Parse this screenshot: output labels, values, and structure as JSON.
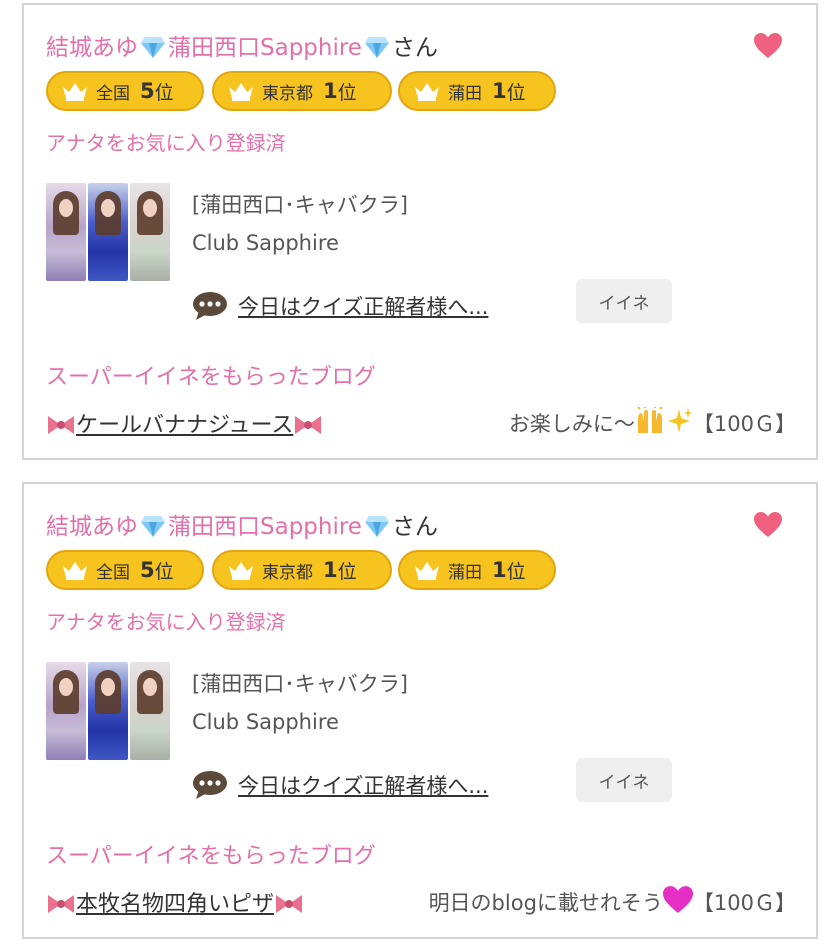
{
  "cards": [
    {
      "name_part1": "結城あゆ",
      "name_part2": "蒲田西口Sapphire",
      "name_suffix": "さん",
      "rank_national_label": "全国",
      "rank_national_value": "5",
      "rank_tokyo_label": "東京都",
      "rank_tokyo_value": "1",
      "rank_kamata_label": "蒲田",
      "rank_kamata_value": "1",
      "rank_unit": "位",
      "favorite_status": "アナタをお気に入り登録済",
      "category": "[蒲田西口･キャバクラ]",
      "shop": "Club Sapphire",
      "post_title": "今日はクイズ正解者様へ...",
      "iine_label": "イイネ",
      "super_iine_heading": "スーパーイイネをもらったブログ",
      "blog_title": "ケールバナナジュース",
      "blog_comment": "お楽しみに〜",
      "blog_points": "【100Ｇ】"
    },
    {
      "name_part1": "結城あゆ",
      "name_part2": "蒲田西口Sapphire",
      "name_suffix": "さん",
      "rank_national_label": "全国",
      "rank_national_value": "5",
      "rank_tokyo_label": "東京都",
      "rank_tokyo_value": "1",
      "rank_kamata_label": "蒲田",
      "rank_kamata_value": "1",
      "rank_unit": "位",
      "favorite_status": "アナタをお気に入り登録済",
      "category": "[蒲田西口･キャバクラ]",
      "shop": "Club Sapphire",
      "post_title": "今日はクイズ正解者様へ...",
      "iine_label": "イイネ",
      "super_iine_heading": "スーパーイイネをもらったブログ",
      "blog_title": "本牧名物四角いピザ",
      "blog_comment": "明日のblogに載せれそう",
      "blog_points": "【100Ｇ】"
    }
  ],
  "colors": {
    "accent_pink": "#e56fa9",
    "heart": "#f0607f",
    "badge_gold": "#f7c31f"
  },
  "icons": [
    "diamond-icon",
    "heart-icon",
    "crown-icon",
    "speech-bubble-icon",
    "ribbon-icon",
    "raised-hands-icon",
    "sparkles-icon",
    "pink-heart-icon"
  ]
}
